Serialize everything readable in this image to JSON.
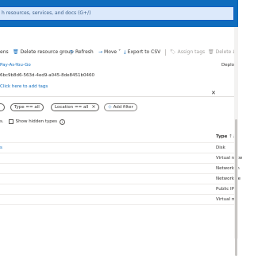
{
  "search": {
    "placeholder": "h resources, services, and docs (G+/)"
  },
  "toolbar": {
    "columns_label": "ens",
    "delete_group_label": "Delete resource group",
    "refresh_label": "Refresh",
    "move_label": "Move",
    "export_label": "Export to CSV",
    "assign_tags_label": "Assign tags",
    "delete_label": "Delete",
    "deploy_label": "Deploy"
  },
  "essentials": {
    "subscription": "Pay-As-You-Go",
    "subscription_id": "6bc9b8d6-563d-4ed9-a045-8de8451b0460",
    "tags_link": "Click here to add tags"
  },
  "filters": {
    "type_label": "Type == all",
    "location_label": "Location == all",
    "add_filter_label": "Add filter",
    "show_hidden_label": "Show hidden types",
    "count_suffix": "s."
  },
  "table": {
    "type_header": "Type",
    "rows": [
      {
        "name": "s",
        "type": "Disk"
      },
      {
        "name": "",
        "type": "Virtual netw"
      },
      {
        "name": "",
        "type": "Network in"
      },
      {
        "name": "",
        "type": "Network se"
      },
      {
        "name": "",
        "type": "Public IP a"
      },
      {
        "name": "",
        "type": "Virtual ma"
      }
    ]
  },
  "colors": {
    "accent": "#0f6cbd",
    "header": "#0f6cbd"
  }
}
